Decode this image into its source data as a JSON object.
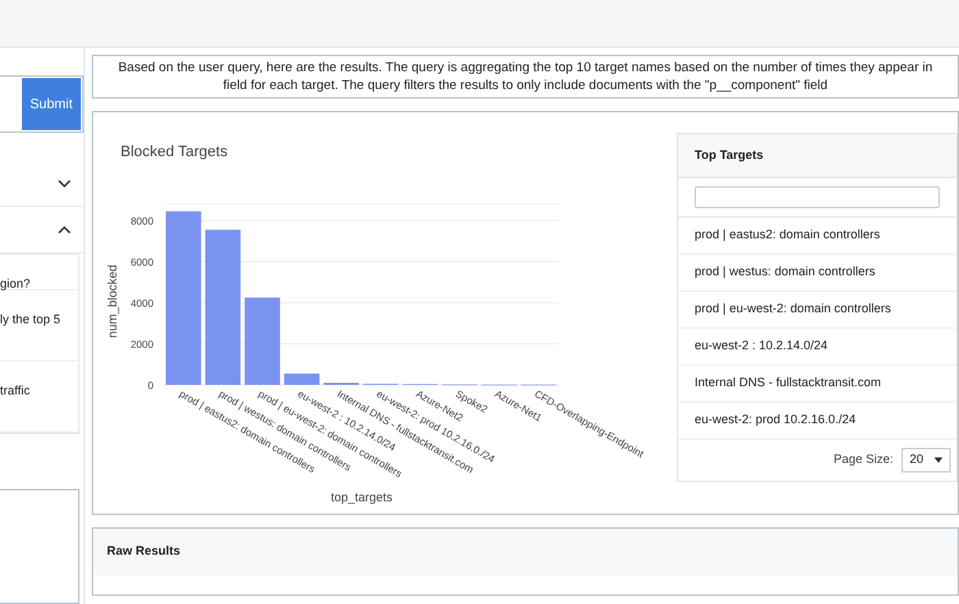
{
  "sidebar": {
    "submit_label": "Submit",
    "sections": [
      {
        "expanded": false
      },
      {
        "expanded": true
      }
    ],
    "suggestions": [
      "gion?",
      "ly the top 5",
      "traffic"
    ]
  },
  "summary": {
    "lines": [
      "Based on the user query, here are the results. The query is aggregating the top 10 target names based on the number of times they appear in",
      "field for each target. The query filters the results to only include documents with the \"p__component\" field"
    ]
  },
  "chart": {
    "chart_data": {
      "type": "bar",
      "title": "Blocked Targets",
      "xlabel": "top_targets",
      "ylabel": "num_blocked",
      "categories": [
        "prod | eastus2: domain controllers",
        "prod | westus: domain controllers",
        "prod | eu-west-2: domain controllers",
        "eu-west-2 : 10.2.14.0/24",
        "Internal DNS - fullstacktransit.com",
        "eu-west-2: prod 10.2.16.0./24",
        "Azure-Net2",
        "Spoke2",
        "Azure-Net1",
        "CFD-Overlapping-Endpoint"
      ],
      "series": [
        {
          "color": "#7b93f0",
          "values": [
            8450,
            7550,
            4250,
            550,
            100,
            50,
            40,
            20,
            10,
            10
          ]
        }
      ],
      "grid": true,
      "ylim": [
        0,
        8800
      ],
      "yticks": [
        0,
        2000,
        4000,
        6000,
        8000
      ]
    }
  },
  "table": {
    "title": "Top Targets",
    "rows": [
      "prod | eastus2: domain controllers",
      "prod | westus: domain controllers",
      "prod | eu-west-2: domain controllers",
      "eu-west-2 : 10.2.14.0/24",
      "Internal DNS - fullstacktransit.com",
      "eu-west-2: prod 10.2.16.0./24"
    ],
    "page_size_label": "Page Size:",
    "page_size": "20"
  },
  "raw_results": {
    "title": "Raw Results"
  }
}
